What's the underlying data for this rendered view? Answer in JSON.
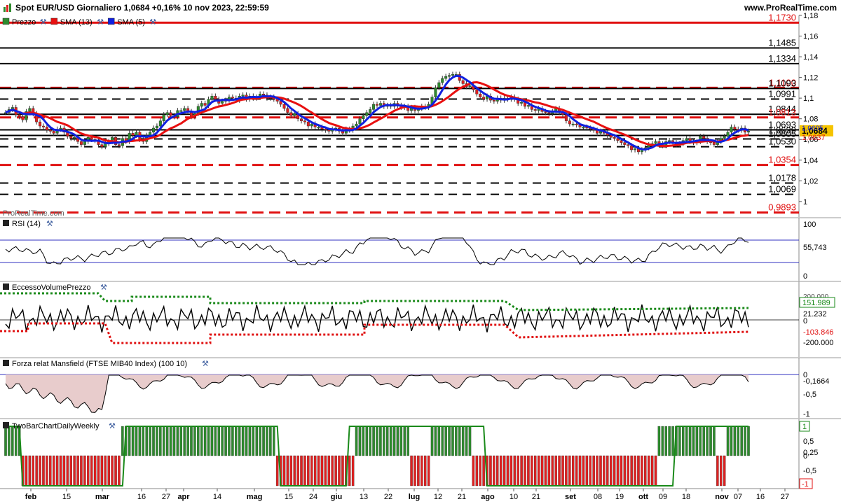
{
  "header": {
    "title": "Spot EUR/USD Giornaliero 1,0684 +0,16% 10 nov 2023, 22:59:59",
    "brand": "www.ProRealTime.com",
    "watermark": "ProRealTime.com"
  },
  "colors": {
    "up": "#2e8b2e",
    "down": "#e02020",
    "sma13": "#e81010",
    "sma5": "#1020e0",
    "level_red": "#e01010",
    "level_black": "#000000",
    "price_badge": "#f5c400",
    "area_fill": "#e8cccc",
    "rsi_band": "#3030c0"
  },
  "panels": {
    "price": {
      "legend": [
        {
          "label": "Prezzo",
          "color": "#2e8b2e"
        },
        {
          "label": "SMA (13)",
          "color": "#e81010"
        },
        {
          "label": "SMA (5)",
          "color": "#1020e0"
        }
      ],
      "last_price": "1,0684",
      "sma13_value": "1,0637",
      "sma5_value": "1,0605"
    },
    "rsi": {
      "legend": "RSI (14)",
      "value": "55,743",
      "ticks": [
        "100",
        "0"
      ]
    },
    "evp": {
      "legend": "EccessoVolumePrezzo",
      "values": [
        "151.989",
        "21.232",
        "0",
        "-103.846"
      ],
      "ticks": [
        "200.000",
        "-200.000"
      ]
    },
    "mansfield": {
      "legend": "Forza relat Mansfield (FTSE MIB40 Index) (100 10)",
      "value": "-0,1664",
      "ticks": [
        "0",
        "-0,5",
        "-1"
      ]
    },
    "twobar": {
      "legend": "TwoBarChartDailyWeekly",
      "values": [
        "1",
        "-1"
      ],
      "ticks": [
        "0,5",
        "0,25",
        "0",
        "-0,5"
      ]
    }
  },
  "chart_data": {
    "type": "candlestick",
    "title": "Spot EUR/USD Giornaliero",
    "y_axis_ticks": [
      1.18,
      1.16,
      1.14,
      1.12,
      1.1,
      1.08,
      1.06,
      1.04,
      1.02,
      1
    ],
    "y_axis_labels": [
      "1,18",
      "1,16",
      "1,14",
      "1,12",
      "1,1",
      "1,08",
      "1,06",
      "1,04",
      "1,02",
      "1"
    ],
    "ylim": [
      0.985,
      1.18
    ],
    "x_axis_labels": [
      "feb",
      "15",
      "mar",
      "16",
      "27",
      "apr",
      "14",
      "mag",
      "15",
      "24",
      "giu",
      "13",
      "22",
      "lug",
      "12",
      "21",
      "ago",
      "10",
      "21",
      "set",
      "08",
      "19",
      "ott",
      "09",
      "18",
      "nov",
      "07",
      "16",
      "27"
    ],
    "levels": [
      {
        "value": 1.173,
        "label": "1,1730",
        "style": "solid",
        "color": "red"
      },
      {
        "value": 1.1485,
        "label": "1,1485",
        "style": "solid",
        "color": "black"
      },
      {
        "value": 1.1334,
        "label": "1,1334",
        "style": "solid",
        "color": "black"
      },
      {
        "value": 1.11,
        "label": "1,1100",
        "style": "dashed",
        "color": "red"
      },
      {
        "value": 1.1093,
        "label": "1,1093",
        "style": "solid",
        "color": "black"
      },
      {
        "value": 1.0991,
        "label": "1,0991",
        "style": "dashed",
        "color": "black"
      },
      {
        "value": 1.0844,
        "label": "1,0844",
        "style": "solid",
        "color": "black"
      },
      {
        "value": 1.0813,
        "label": "1,0813",
        "style": "dashed",
        "color": "red"
      },
      {
        "value": 1.0693,
        "label": "1,0693",
        "style": "solid",
        "color": "black"
      },
      {
        "value": 1.0639,
        "label": "1,0639",
        "style": "solid",
        "color": "black"
      },
      {
        "value": 1.0605,
        "label": "1,0605",
        "style": "dashed",
        "color": "black"
      },
      {
        "value": 1.053,
        "label": "1,0530",
        "style": "dashed",
        "color": "black"
      },
      {
        "value": 1.0354,
        "label": "1,0354",
        "style": "dashed",
        "color": "red"
      },
      {
        "value": 1.0178,
        "label": "1,0178",
        "style": "dashed",
        "color": "black"
      },
      {
        "value": 1.0069,
        "label": "1,0069",
        "style": "dashed",
        "color": "black"
      },
      {
        "value": 0.9893,
        "label": "0,9893",
        "style": "dashed",
        "color": "red"
      }
    ],
    "close": [
      1.086,
      1.089,
      1.091,
      1.084,
      1.082,
      1.079,
      1.087,
      1.09,
      1.085,
      1.077,
      1.073,
      1.072,
      1.069,
      1.068,
      1.066,
      1.07,
      1.071,
      1.067,
      1.063,
      1.061,
      1.062,
      1.058,
      1.055,
      1.058,
      1.062,
      1.06,
      1.059,
      1.055,
      1.053,
      1.056,
      1.058,
      1.062,
      1.055,
      1.054,
      1.061,
      1.058,
      1.066,
      1.064,
      1.067,
      1.06,
      1.058,
      1.064,
      1.067,
      1.071,
      1.073,
      1.078,
      1.084,
      1.086,
      1.083,
      1.082,
      1.088,
      1.088,
      1.09,
      1.087,
      1.082,
      1.085,
      1.092,
      1.095,
      1.093,
      1.099,
      1.102,
      1.099,
      1.095,
      1.097,
      1.098,
      1.101,
      1.1,
      1.098,
      1.102,
      1.103,
      1.099,
      1.102,
      1.1,
      1.101,
      1.104,
      1.103,
      1.1,
      1.101,
      1.099,
      1.097,
      1.094,
      1.09,
      1.086,
      1.083,
      1.085,
      1.08,
      1.078,
      1.077,
      1.073,
      1.075,
      1.072,
      1.072,
      1.07,
      1.069,
      1.068,
      1.07,
      1.071,
      1.068,
      1.066,
      1.07,
      1.069,
      1.073,
      1.075,
      1.08,
      1.083,
      1.086,
      1.089,
      1.094,
      1.093,
      1.095,
      1.092,
      1.093,
      1.092,
      1.095,
      1.093,
      1.091,
      1.092,
      1.088,
      1.091,
      1.088,
      1.09,
      1.092,
      1.091,
      1.094,
      1.101,
      1.11,
      1.115,
      1.119,
      1.121,
      1.122,
      1.123,
      1.123,
      1.117,
      1.114,
      1.111,
      1.112,
      1.108,
      1.104,
      1.101,
      1.099,
      1.102,
      1.098,
      1.097,
      1.1,
      1.098,
      1.1,
      1.099,
      1.101,
      1.099,
      1.095,
      1.096,
      1.092,
      1.093,
      1.089,
      1.088,
      1.09,
      1.087,
      1.086,
      1.085,
      1.087,
      1.09,
      1.086,
      1.084,
      1.078,
      1.075,
      1.075,
      1.074,
      1.072,
      1.072,
      1.071,
      1.07,
      1.069,
      1.066,
      1.068,
      1.066,
      1.064,
      1.062,
      1.061,
      1.059,
      1.057,
      1.055,
      1.054,
      1.05,
      1.051,
      1.048,
      1.05,
      1.052,
      1.055,
      1.056,
      1.058,
      1.056,
      1.054,
      1.058,
      1.059,
      1.057,
      1.055,
      1.056,
      1.059,
      1.061,
      1.058,
      1.057,
      1.058,
      1.063,
      1.061,
      1.058,
      1.057,
      1.055,
      1.058,
      1.061,
      1.063,
      1.067,
      1.072,
      1.07,
      1.069,
      1.071,
      1.067,
      1.068
    ]
  }
}
